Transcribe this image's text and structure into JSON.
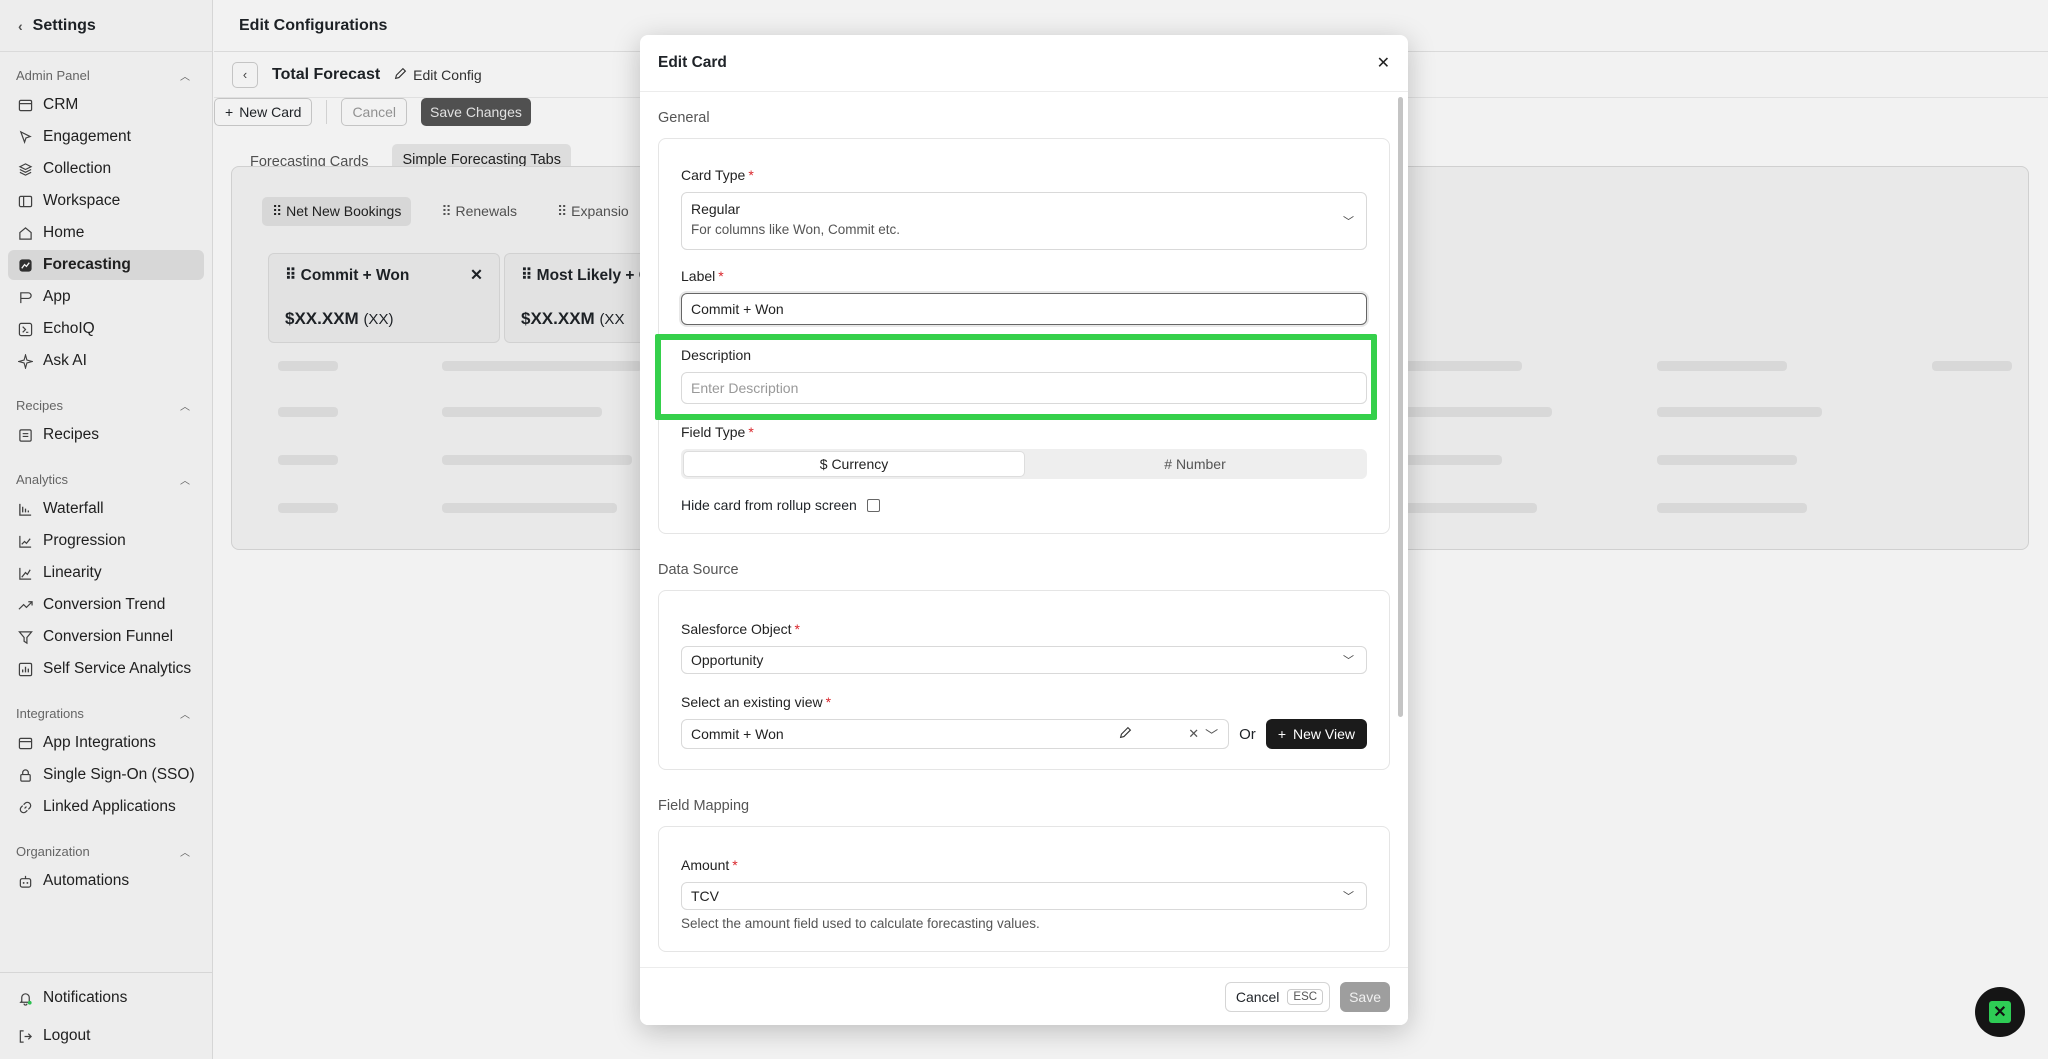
{
  "sidebar": {
    "back_label": "Settings",
    "sections": [
      {
        "title": "Admin Panel",
        "items": [
          {
            "label": "CRM",
            "icon": "crm-icon"
          },
          {
            "label": "Engagement",
            "icon": "cursor-icon"
          },
          {
            "label": "Collection",
            "icon": "layers-icon"
          },
          {
            "label": "Workspace",
            "icon": "workspace-icon"
          },
          {
            "label": "Home",
            "icon": "home-icon"
          },
          {
            "label": "Forecasting",
            "icon": "forecasting-icon",
            "active": true
          },
          {
            "label": "App",
            "icon": "app-icon"
          },
          {
            "label": "EchoIQ",
            "icon": "echoiq-icon"
          },
          {
            "label": "Ask AI",
            "icon": "sparkle-icon"
          }
        ]
      },
      {
        "title": "Recipes",
        "items": [
          {
            "label": "Recipes",
            "icon": "recipes-icon"
          }
        ]
      },
      {
        "title": "Analytics",
        "items": [
          {
            "label": "Waterfall",
            "icon": "waterfall-icon"
          },
          {
            "label": "Progression",
            "icon": "progression-icon"
          },
          {
            "label": "Linearity",
            "icon": "linearity-icon"
          },
          {
            "label": "Conversion Trend",
            "icon": "trend-icon"
          },
          {
            "label": "Conversion Funnel",
            "icon": "funnel-icon"
          },
          {
            "label": "Self Service Analytics",
            "icon": "analytics-icon"
          }
        ]
      },
      {
        "title": "Integrations",
        "items": [
          {
            "label": "App Integrations",
            "icon": "integrations-icon"
          },
          {
            "label": "Single Sign-On (SSO)",
            "icon": "lock-icon"
          },
          {
            "label": "Linked Applications",
            "icon": "link-icon"
          }
        ]
      },
      {
        "title": "Organization",
        "items": [
          {
            "label": "Automations",
            "icon": "robot-icon"
          }
        ]
      }
    ],
    "notifications_label": "Notifications",
    "logout_label": "Logout"
  },
  "header": {
    "title": "Edit Configurations",
    "forecast_title": "Total Forecast",
    "edit_config_label": "Edit Config",
    "new_card_label": "New Card",
    "cancel_label": "Cancel",
    "save_changes_label": "Save Changes"
  },
  "tabs": [
    "Forecasting Cards",
    "Simple Forecasting Tabs"
  ],
  "inner_tabs": [
    "Net New Bookings",
    "Renewals",
    "Expansio"
  ],
  "cards": [
    {
      "title": "Commit + Won",
      "value": "$XX.XXM",
      "count": "(XX)"
    },
    {
      "title": "Most Likely + C",
      "value": "$XX.XXM",
      "count": "(XX"
    }
  ],
  "modal": {
    "title": "Edit Card",
    "general": {
      "section_title": "General",
      "card_type_label": "Card Type",
      "card_type_value": "Regular",
      "card_type_desc": "For columns like Won, Commit etc.",
      "label_label": "Label",
      "label_value": "Commit + Won",
      "description_label": "Description",
      "description_placeholder": "Enter Description",
      "field_type_label": "Field Type",
      "field_type_options": [
        "$ Currency",
        "# Number"
      ],
      "hide_card_label": "Hide card from rollup screen"
    },
    "data_source": {
      "section_title": "Data Source",
      "object_label": "Salesforce Object",
      "object_value": "Opportunity",
      "view_label": "Select an existing view",
      "view_value": "Commit + Won",
      "or_label": "Or",
      "new_view_label": "New View"
    },
    "field_mapping": {
      "section_title": "Field Mapping",
      "amount_label": "Amount",
      "amount_value": "TCV",
      "amount_helper": "Select the amount field used to calculate forecasting values."
    },
    "footer": {
      "cancel_label": "Cancel",
      "cancel_key": "ESC",
      "save_label": "Save"
    }
  },
  "colors": {
    "highlight": "#35d04b",
    "required": "#d9262c",
    "dark_button": "#1b1b1b"
  }
}
